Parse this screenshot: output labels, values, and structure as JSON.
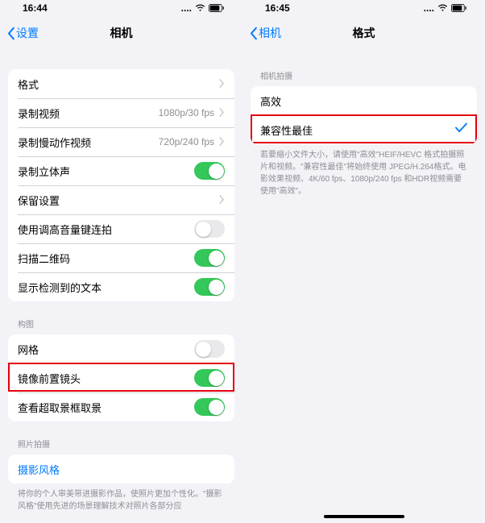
{
  "left": {
    "status_time": "16:44",
    "nav": {
      "back": "设置",
      "title": "相机"
    },
    "group1": [
      {
        "label": "格式",
        "type": "disclosure"
      },
      {
        "label": "录制视频",
        "value": "1080p/30 fps",
        "type": "disclosure"
      },
      {
        "label": "录制慢动作视频",
        "value": "720p/240 fps",
        "type": "disclosure"
      },
      {
        "label": "录制立体声",
        "type": "toggle",
        "on": true
      },
      {
        "label": "保留设置",
        "type": "disclosure"
      },
      {
        "label": "使用调高音量键连拍",
        "type": "toggle",
        "on": false
      },
      {
        "label": "扫描二维码",
        "type": "toggle",
        "on": true
      },
      {
        "label": "显示检测到的文本",
        "type": "toggle",
        "on": true
      }
    ],
    "section_composition": "构图",
    "group2": [
      {
        "label": "网格",
        "type": "toggle",
        "on": false
      },
      {
        "label": "镜像前置镜头",
        "type": "toggle",
        "on": true
      },
      {
        "label": "查看超取景框取景",
        "type": "toggle",
        "on": true
      }
    ],
    "section_capture": "照片拍摄",
    "group3": [
      {
        "label": "摄影风格",
        "type": "link"
      }
    ],
    "footer": "将你的个人审美带进摄影作品，使照片更加个性化。\"摄影风格\"使用先进的场景理解技术对照片各部分应"
  },
  "right": {
    "status_time": "16:45",
    "nav": {
      "back": "相机",
      "title": "格式"
    },
    "section_capture": "相机拍摄",
    "rows": [
      {
        "label": "高效",
        "selected": false
      },
      {
        "label": "兼容性最佳",
        "selected": true
      }
    ],
    "footer": "若要缩小文件大小，请使用\"高效\"HEIF/HEVC 格式拍摄照片和视频。\"兼容性最佳\"将始终使用 JPEG/H.264格式。电影效果视频、4K/60 fps、1080p/240 fps 和HDR视频需要使用\"高效\"。"
  },
  "colors": {
    "accent": "#007aff",
    "green": "#34c759",
    "red": "#e1000f"
  }
}
